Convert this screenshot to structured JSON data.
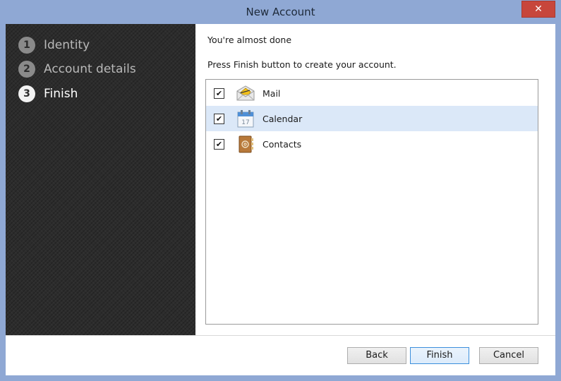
{
  "window": {
    "title": "New Account",
    "close_glyph": "✕"
  },
  "sidebar": {
    "steps": [
      {
        "num": "1",
        "label": "Identity",
        "active": false
      },
      {
        "num": "2",
        "label": "Account details",
        "active": false
      },
      {
        "num": "3",
        "label": "Finish",
        "active": true
      }
    ]
  },
  "main": {
    "heading": "You're almost done",
    "instruction": "Press Finish button to create your account.",
    "items": [
      {
        "label": "Mail",
        "checked": true,
        "icon": "mail-icon",
        "selected": false
      },
      {
        "label": "Calendar",
        "checked": true,
        "icon": "calendar-icon",
        "calendar_day": "17",
        "selected": true
      },
      {
        "label": "Contacts",
        "checked": true,
        "icon": "contacts-icon",
        "selected": false
      }
    ]
  },
  "footer": {
    "back_label": "Back",
    "finish_label": "Finish",
    "cancel_label": "Cancel"
  },
  "colors": {
    "titlebar": "#8fa8d4",
    "close": "#c7463b",
    "sidebar": "#2c2c2c",
    "selected_row": "#dbe8f8"
  }
}
